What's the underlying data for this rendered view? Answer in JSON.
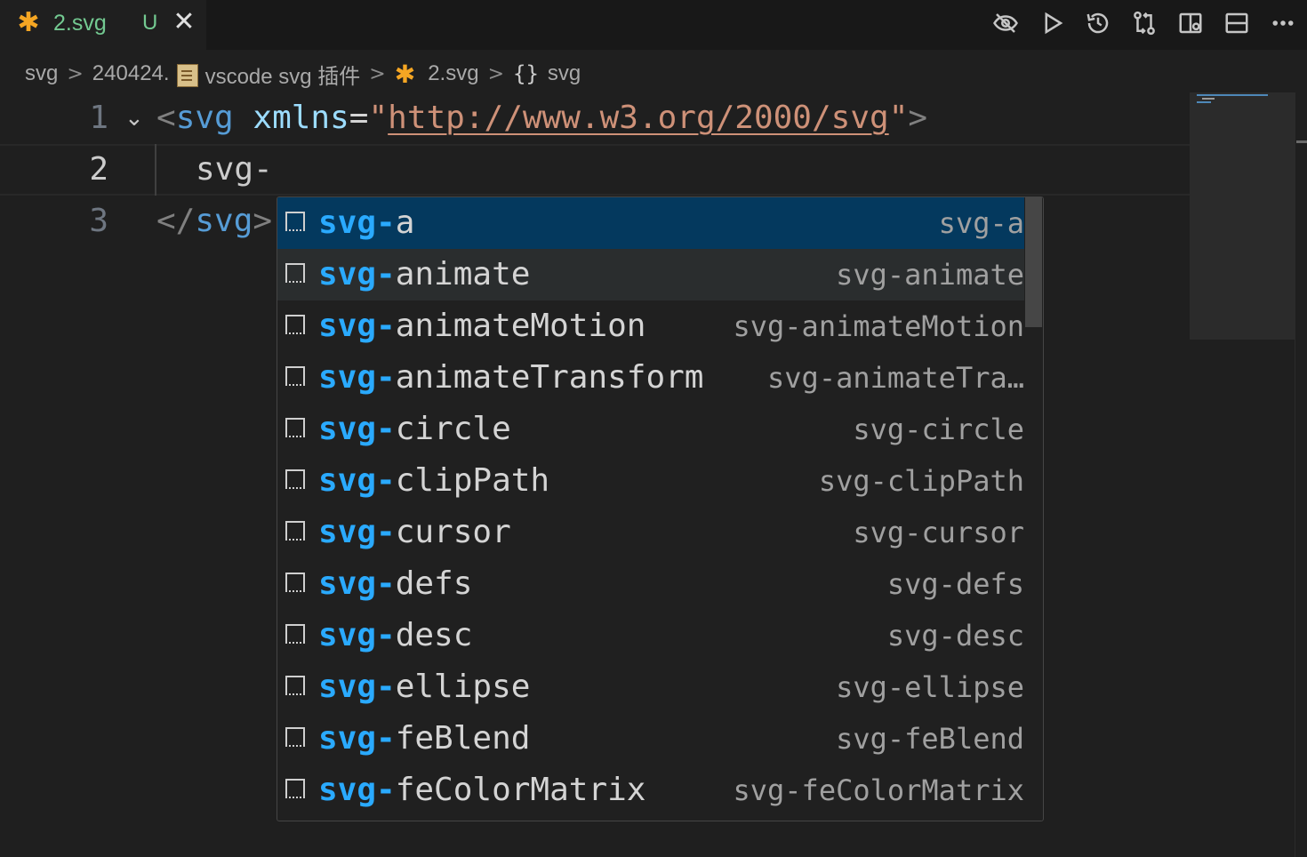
{
  "tab": {
    "icon": "svg-file-icon",
    "title": "2.svg",
    "status": "U",
    "close": "✕"
  },
  "toolbar_actions": [
    {
      "name": "preview-hidden-icon"
    },
    {
      "name": "run-icon"
    },
    {
      "name": "history-icon"
    },
    {
      "name": "compare-changes-icon"
    },
    {
      "name": "split-editor-right-icon"
    },
    {
      "name": "split-editor-down-icon"
    },
    {
      "name": "more-actions-icon"
    }
  ],
  "breadcrumb": {
    "items": [
      "svg",
      "240424.",
      "vscode svg 插件",
      "2.svg",
      "svg"
    ],
    "separator": ">",
    "braces": "{}"
  },
  "editor": {
    "lines": [
      {
        "number": "1",
        "parts": [
          "<",
          "svg",
          " ",
          "xmlns",
          "=",
          "\"",
          "http://www.w3.org/2000/svg",
          "\"",
          ">"
        ]
      },
      {
        "number": "2",
        "text": "svg-"
      },
      {
        "number": "3",
        "parts": [
          "</",
          "svg",
          ">"
        ]
      }
    ],
    "fold_glyph": "⌄"
  },
  "suggestions": {
    "match_prefix": "svg-",
    "items": [
      {
        "rest": "a",
        "detail": "svg-a",
        "state": "selected"
      },
      {
        "rest": "animate",
        "detail": "svg-animate",
        "state": "hover"
      },
      {
        "rest": "animateMotion",
        "detail": "svg-animateMotion"
      },
      {
        "rest": "animateTransform",
        "detail": "svg-animateTra…"
      },
      {
        "rest": "circle",
        "detail": "svg-circle"
      },
      {
        "rest": "clipPath",
        "detail": "svg-clipPath"
      },
      {
        "rest": "cursor",
        "detail": "svg-cursor"
      },
      {
        "rest": "defs",
        "detail": "svg-defs"
      },
      {
        "rest": "desc",
        "detail": "svg-desc"
      },
      {
        "rest": "ellipse",
        "detail": "svg-ellipse"
      },
      {
        "rest": "feBlend",
        "detail": "svg-feBlend"
      },
      {
        "rest": "feColorMatrix",
        "detail": "svg-feColorMatrix"
      }
    ]
  },
  "colors": {
    "accent_selected": "#04395e",
    "match_highlight": "#2aaaff",
    "untracked_green": "#73c991",
    "svg_icon_orange": "#f5a623"
  }
}
